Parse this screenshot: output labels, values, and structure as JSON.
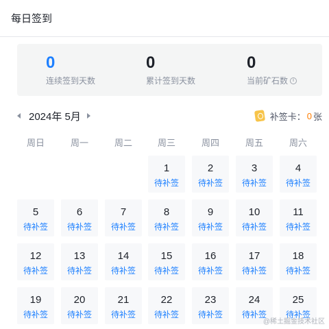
{
  "header": {
    "title": "每日签到"
  },
  "stats": [
    {
      "value": "0",
      "label": "连续签到天数"
    },
    {
      "value": "0",
      "label": "累计签到天数"
    },
    {
      "value": "0",
      "label": "当前矿石数",
      "info": "i"
    }
  ],
  "calendar": {
    "month_label": "2024年 5月",
    "card_label": "补签卡：",
    "card_count": "0",
    "card_unit": "张",
    "weekdays": [
      "周日",
      "周一",
      "周二",
      "周三",
      "周四",
      "周五",
      "周六"
    ],
    "days": [
      {
        "num": "1",
        "status": "待补签"
      },
      {
        "num": "2",
        "status": "待补签"
      },
      {
        "num": "3",
        "status": "待补签"
      },
      {
        "num": "4",
        "status": "待补签"
      },
      {
        "num": "5",
        "status": "待补签"
      },
      {
        "num": "6",
        "status": "待补签"
      },
      {
        "num": "7",
        "status": "待补签"
      },
      {
        "num": "8",
        "status": "待补签"
      },
      {
        "num": "9",
        "status": "待补签"
      },
      {
        "num": "10",
        "status": "待补签"
      },
      {
        "num": "11",
        "status": "待补签"
      },
      {
        "num": "12",
        "status": "待补签"
      },
      {
        "num": "13",
        "status": "待补签"
      },
      {
        "num": "14",
        "status": "待补签"
      },
      {
        "num": "15",
        "status": "待补签"
      },
      {
        "num": "16",
        "status": "待补签"
      },
      {
        "num": "17",
        "status": "待补签"
      },
      {
        "num": "18",
        "status": "待补签"
      },
      {
        "num": "19",
        "status": "待补签"
      },
      {
        "num": "20",
        "status": "待补签"
      },
      {
        "num": "21",
        "status": "待补签"
      },
      {
        "num": "22",
        "status": "待补签"
      },
      {
        "num": "23",
        "status": "待补签"
      },
      {
        "num": "24",
        "status": "待补签"
      },
      {
        "num": "25",
        "status": "待补签"
      }
    ]
  },
  "watermark": "@稀土掘金技术社区",
  "colors": {
    "accent": "#1e80ff",
    "card_count": "#ff7d00"
  }
}
